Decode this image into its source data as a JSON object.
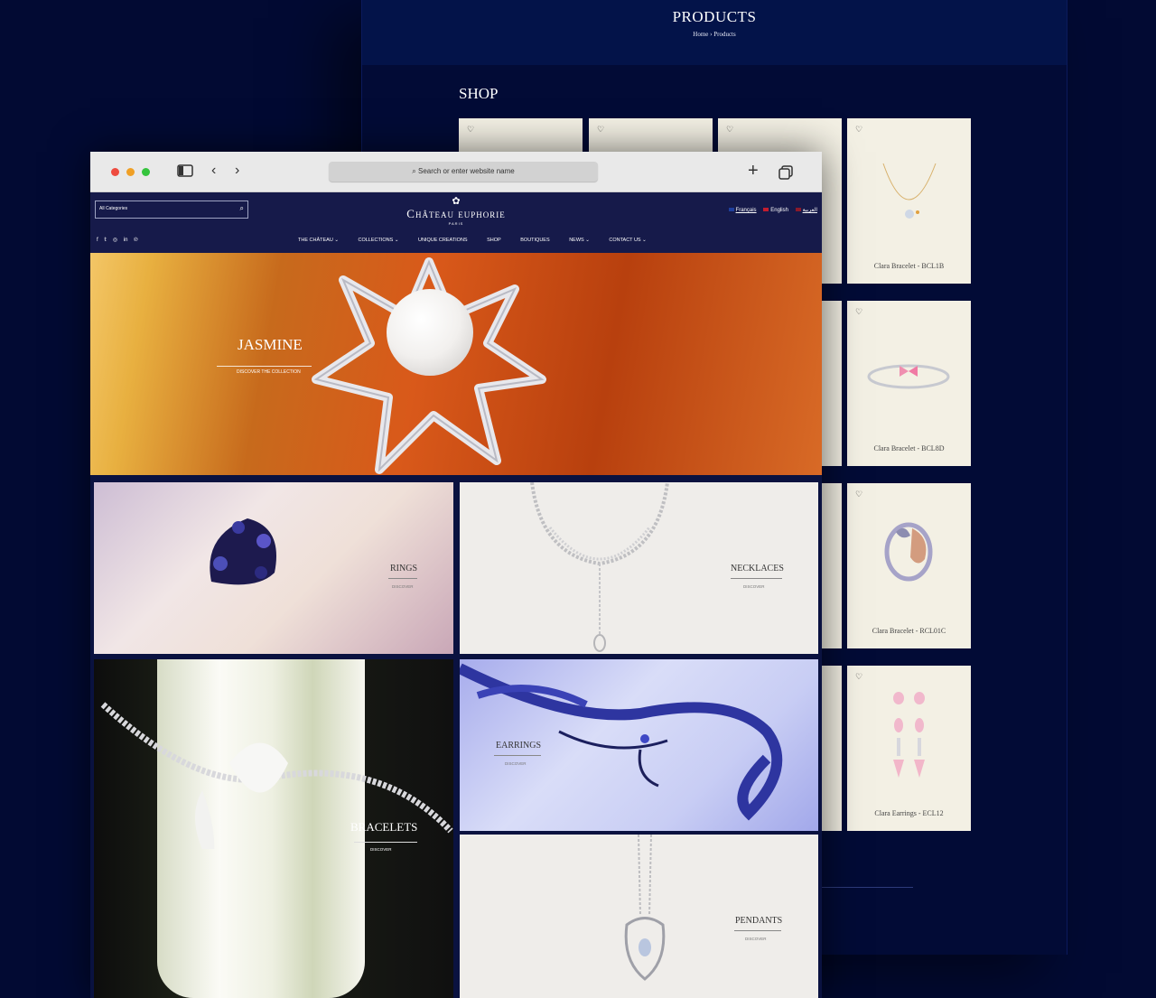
{
  "back_page": {
    "hero_title": "PRODUCTS",
    "breadcrumb": {
      "home": "Home",
      "separator": "›",
      "current": "Products"
    },
    "shop_title": "SHOP",
    "products": [
      {
        "name": "Clara Bracelet - BCL1B",
        "image": "gold-chain-bracelet"
      },
      {
        "name": "Clara Bracelet - BCL8D",
        "image": "bangle-pink-bow"
      },
      {
        "name": "Clara Bracelet - RCL01C",
        "image": "lion-ring"
      },
      {
        "name": "Clara Earrings - ECL12",
        "image": "pink-drop-earrings"
      }
    ]
  },
  "browser": {
    "address_placeholder": "Search or enter website name",
    "icons": [
      "sidebar-icon",
      "back-arrow-icon",
      "forward-arrow-icon",
      "plus-icon",
      "tabs-icon"
    ]
  },
  "site": {
    "search": {
      "category": "All Categories"
    },
    "logo": {
      "name": "Château euphorie",
      "sub": "PARIS"
    },
    "languages": [
      {
        "label": "Français",
        "flag": "#1f3f9c"
      },
      {
        "label": "English",
        "flag": "#c21d2f"
      },
      {
        "label": "العربية",
        "flag": "#8b1a2b"
      }
    ],
    "social": [
      "facebook-icon",
      "twitter-icon",
      "instagram-icon",
      "linkedin-icon",
      "pinterest-icon"
    ],
    "nav": [
      {
        "label": "THE CHÂTEAU",
        "dropdown": true
      },
      {
        "label": "COLLECTIONS",
        "dropdown": true
      },
      {
        "label": "UNIQUE CREATIONS",
        "dropdown": false
      },
      {
        "label": "SHOP",
        "dropdown": false
      },
      {
        "label": "BOUTIQUES",
        "dropdown": false
      },
      {
        "label": "NEWS",
        "dropdown": true
      },
      {
        "label": "CONTACT US",
        "dropdown": true
      }
    ],
    "banner": {
      "title": "JASMINE",
      "cta": "DISCOVER THE COLLECTION"
    },
    "categories": [
      {
        "label": "RINGS",
        "cta": "DISCOVER"
      },
      {
        "label": "NECKLACES",
        "cta": "DISCOVER"
      },
      {
        "label": "BRACELETS",
        "cta": "DISCOVER"
      },
      {
        "label": "EARRINGS",
        "cta": "DISCOVER"
      },
      {
        "label": "PENDANTS",
        "cta": "DISCOVER"
      }
    ]
  }
}
